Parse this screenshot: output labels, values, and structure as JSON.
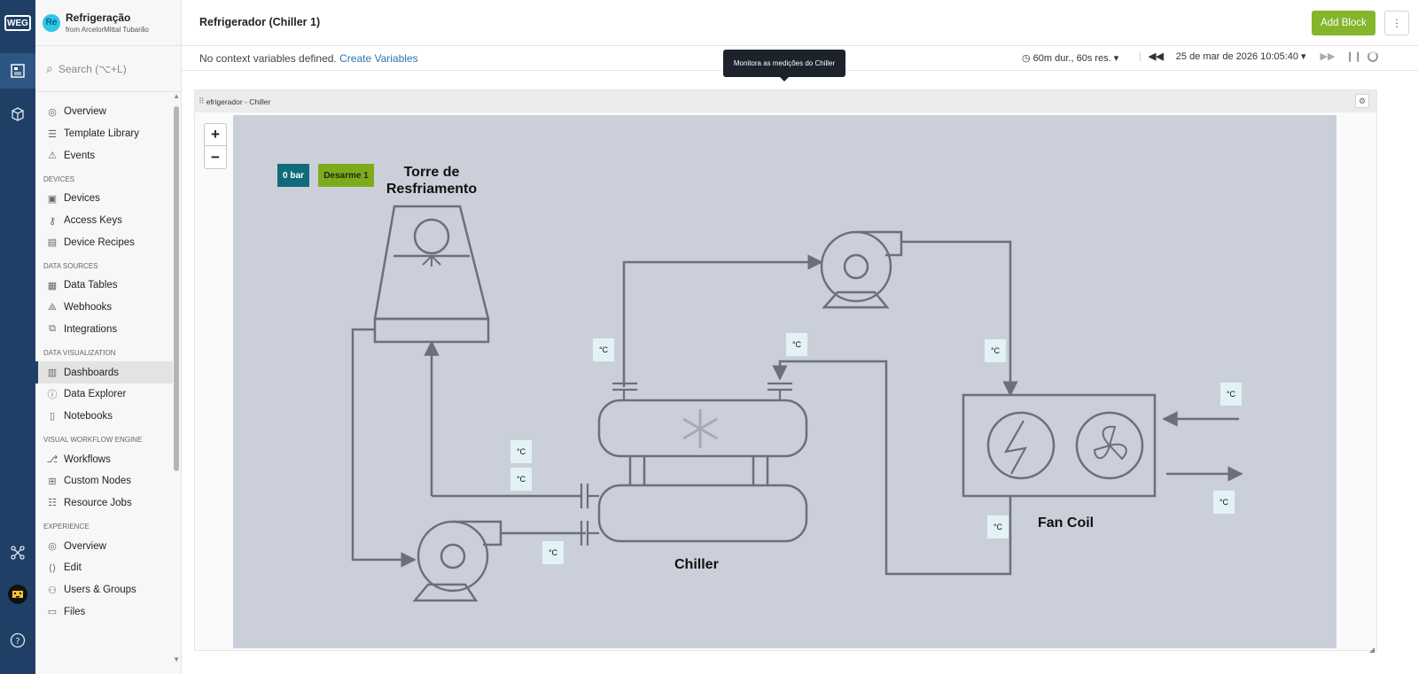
{
  "rail": {
    "logo": "WEG"
  },
  "app": {
    "avatar": "Re",
    "name": "Refrigeração",
    "org": "from ArcelorMittal Tubarão"
  },
  "search": {
    "placeholder": "Search (⌥+L)"
  },
  "nav": {
    "top": [
      "Overview",
      "Template Library",
      "Events"
    ],
    "devices_title": "DEVICES",
    "devices": [
      "Devices",
      "Access Keys",
      "Device Recipes"
    ],
    "data_sources_title": "DATA SOURCES",
    "data_sources": [
      "Data Tables",
      "Webhooks",
      "Integrations"
    ],
    "data_viz_title": "DATA VISUALIZATION",
    "data_viz": [
      "Dashboards",
      "Data Explorer",
      "Notebooks"
    ],
    "workflow_title": "VISUAL WORKFLOW ENGINE",
    "workflow": [
      "Workflows",
      "Custom Nodes",
      "Resource Jobs"
    ],
    "experience_title": "EXPERIENCE",
    "experience": [
      "Overview",
      "Edit",
      "Users & Groups",
      "Files"
    ]
  },
  "header": {
    "title": "Refrigerador (Chiller 1)",
    "add_block": "Add Block",
    "more": "⋮"
  },
  "context": {
    "text": "No context variables defined.",
    "link": "Create Variables"
  },
  "time": {
    "duration": "60m dur., 60s res.",
    "date": "25 de mar de 2026 10:05:40"
  },
  "tooltip": "Monitora as medições do Chiller",
  "block": {
    "title": "efrigerador - Chiller"
  },
  "zoom": {
    "plus": "+",
    "minus": "−"
  },
  "diagram": {
    "pressure_badge": "0 bar",
    "status_badge": "Desarme 1",
    "tower_label_1": "Torre de",
    "tower_label_2": "Resfriamento",
    "chiller_label": "Chiller",
    "fancoil_label": "Fan Coil",
    "temp_unit": "°C"
  },
  "colors": {
    "rail": "#1f3f66",
    "accent_green": "#84b52a",
    "teal_badge": "#0f6b7a",
    "green_badge": "#7eab1c",
    "diagram_bg": "#cbcfda",
    "line": "#6b6f7e",
    "temp_box": "#e3f2f5"
  }
}
